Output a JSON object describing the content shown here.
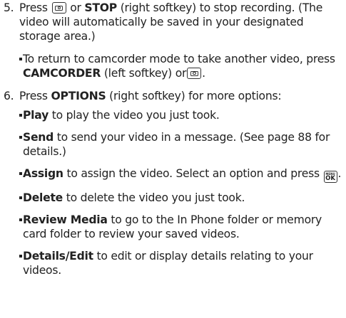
{
  "step5": {
    "number": "5.",
    "t1": "Press",
    "t2": "or",
    "stop": "STOP",
    "t3": "(right softkey) to stop recording. (The video will automatically be saved in your designated storage area.)",
    "bullet": {
      "t1": "To return to camcorder mode to take another video, press",
      "camcorder": "CAMCORDER",
      "t2": "(left softkey) or",
      "t3": "."
    }
  },
  "step6": {
    "number": "6.",
    "t1": "Press",
    "options": "OPTIONS",
    "t2": "(right softkey) for more options:",
    "items": [
      {
        "label": "Play",
        "text": "to play the video you just took."
      },
      {
        "label": "Send",
        "text": "to send your video in a message. (See page 88 for details.)"
      },
      {
        "label": "Assign",
        "text": "to assign the video. Select an option and press",
        "end": "."
      },
      {
        "label": "Delete",
        "text": "to delete the video you just took."
      },
      {
        "label": "Review Media",
        "text": "to go to the In Phone folder or memory card folder to review your saved videos."
      },
      {
        "label": "Details/Edit",
        "text": "to edit or display details relating to your videos."
      }
    ]
  },
  "icons": {
    "camera_key": "camera-key-icon",
    "menu_ok_key": "menu-ok-key-icon",
    "menu_ok_small": "MENU",
    "menu_ok_big": "OK"
  }
}
